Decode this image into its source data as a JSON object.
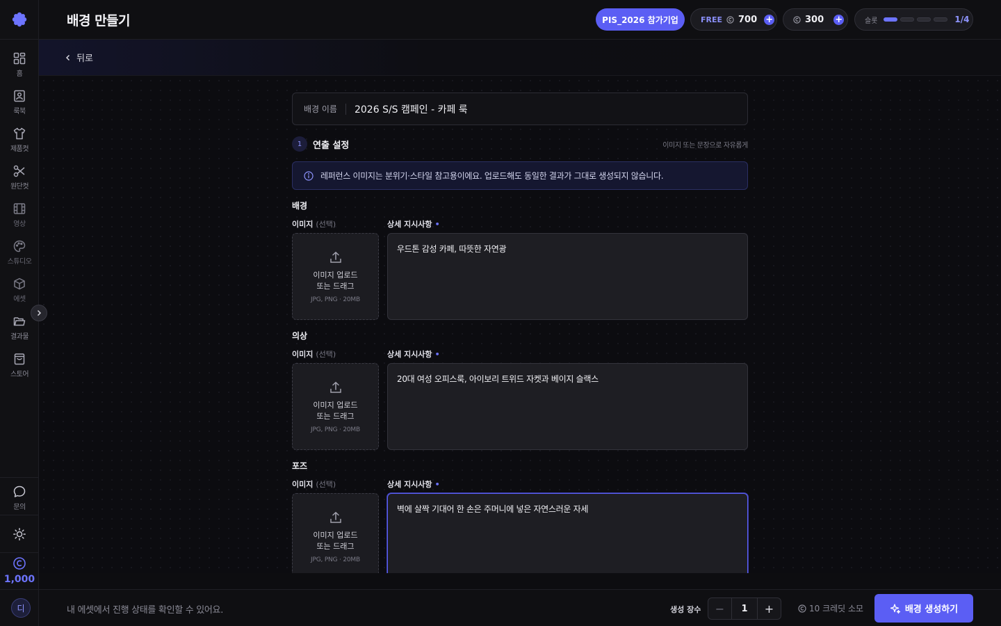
{
  "header": {
    "title": "배경 만들기",
    "event_badge": "PIS_2026 참가기업",
    "free_label": "FREE",
    "free_credits": "700",
    "credits": "300",
    "slot_label": "슬롯",
    "slot_count": "1/4",
    "slots_used": 1,
    "slots_total": 4
  },
  "sidebar": {
    "items": [
      {
        "label": "홈",
        "icon": "grid-icon"
      },
      {
        "label": "룩북",
        "icon": "image-icon"
      },
      {
        "label": "제품컷",
        "icon": "shirt-icon"
      },
      {
        "label": "원단컷",
        "icon": "scissors-icon"
      },
      {
        "label": "영상",
        "icon": "film-icon"
      },
      {
        "label": "스튜디오",
        "icon": "palette-icon"
      },
      {
        "label": "에셋",
        "icon": "cube-icon"
      },
      {
        "label": "결과물",
        "icon": "folder-icon"
      },
      {
        "label": "스토어",
        "icon": "bag-icon"
      }
    ],
    "inquiry_label": "문의",
    "credit_total": "1,000",
    "avatar_initial": "디"
  },
  "back_label": "뒤로",
  "form": {
    "name_label": "배경 이름",
    "name_value": "2026 S/S 캠페인 - 카페 룩",
    "step_number": "1",
    "step_title": "연출 설정",
    "step_hint": "이미지 또는 문장으로 자유롭게",
    "notice": "레퍼런스 이미지는 분위기·스타일 참고용이에요. 업로드해도 동일한 결과가 그대로 생성되지 않습니다.",
    "image_label": "이미지",
    "optional": "(선택)",
    "detail_label": "상세 지시사항",
    "required_mark": "•",
    "upload_line1": "이미지 업로드",
    "upload_line2": "또는 드래그",
    "upload_hint": "JPG, PNG · 20MB",
    "sections": [
      {
        "title": "배경",
        "detail": "우드톤 감성 카페, 따뜻한 자연광"
      },
      {
        "title": "의상",
        "detail": "20대 여성 오피스룩, 아이보리 트위드 자켓과 베이지 슬랙스"
      },
      {
        "title": "포즈",
        "detail": "벽에 살짝 기대어 한 손은 주머니에 넣은 자연스러운 자세"
      }
    ]
  },
  "footer": {
    "message": "내 에셋에서 진행 상태를 확인할 수 있어요.",
    "count_label": "생성 장수",
    "count_value": "1",
    "minus": "−",
    "plus": "+",
    "cost": "10 크레딧 소모",
    "cta": "배경 생성하기"
  },
  "colors": {
    "accent": "#5b5ef4",
    "background": "#0d0d10"
  }
}
